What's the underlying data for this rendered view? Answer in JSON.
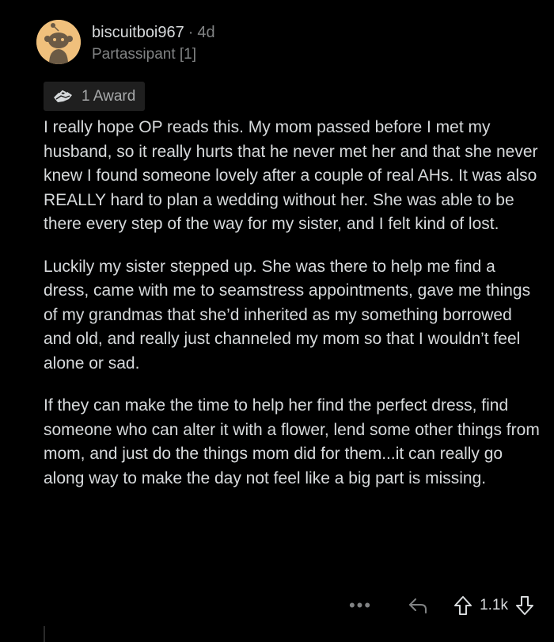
{
  "comment": {
    "username": "biscuitboi967",
    "separator": "·",
    "age": "4d",
    "flair": "Partassipant [1]",
    "award_label": "1 Award",
    "paragraphs": [
      "I really hope OP reads this. My mom passed before I met my husband, so it really hurts that he never met her and that she never knew I found someone lovely after a couple of real AHs. It was also REALLY hard to plan a wedding without her. She was able to be there every step of the way for my sister, and I felt kind of lost.",
      "Luckily my sister stepped up. She was there to help me find a dress, came with me to seamstress appointments, gave me things of my grandmas that she’d inherited as my something borrowed and old, and really just channeled my mom so that I wouldn’t feel alone or sad.",
      "If they can make the time to help her find the perfect dress, find someone who can alter it with a flower, lend some other things from mom, and just do the things mom did for them...it can really go along way to make the day not feel like a big part is missing."
    ]
  },
  "actions": {
    "more_label": "•••",
    "score": "1.1k"
  },
  "icons": {
    "avatar": "reddit-snoo-avatar",
    "award": "helping-hand-award-icon",
    "reply": "reply-arrow-icon",
    "upvote": "upvote-arrow-icon",
    "downvote": "downvote-arrow-icon"
  },
  "colors": {
    "background": "#000000",
    "text": "#d7dadc",
    "muted": "#818384",
    "avatar_bg": "#f0c07c",
    "award_bg": "#1f1f1f"
  }
}
